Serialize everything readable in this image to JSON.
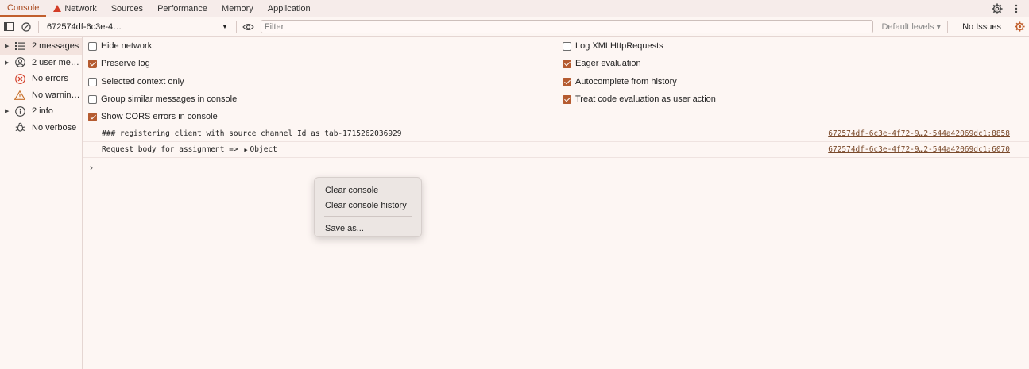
{
  "tabs": [
    {
      "label": "Console",
      "active": true
    },
    {
      "label": "Network",
      "warning": true
    },
    {
      "label": "Sources"
    },
    {
      "label": "Performance"
    },
    {
      "label": "Memory"
    },
    {
      "label": "Application"
    }
  ],
  "toolbar": {
    "context": "672574df-6c3e-4…",
    "filter_placeholder": "Filter",
    "levels": "Default levels ▾",
    "issues": "No Issues"
  },
  "sidebar": {
    "items": [
      {
        "label": "2 messages",
        "icon": "list-icon",
        "expandable": true,
        "selected": true
      },
      {
        "label": "2 user me…",
        "icon": "user-icon",
        "expandable": true
      },
      {
        "label": "No errors",
        "icon": "error-icon"
      },
      {
        "label": "No warnin…",
        "icon": "warning-icon"
      },
      {
        "label": "2 info",
        "icon": "info-icon",
        "expandable": true
      },
      {
        "label": "No verbose",
        "icon": "bug-icon"
      }
    ]
  },
  "settings": {
    "left": [
      {
        "label": "Hide network",
        "checked": false
      },
      {
        "label": "Preserve log",
        "checked": true
      },
      {
        "label": "Selected context only",
        "checked": false
      },
      {
        "label": "Group similar messages in console",
        "checked": false
      },
      {
        "label": "Show CORS errors in console",
        "checked": true
      }
    ],
    "right": [
      {
        "label": "Log XMLHttpRequests",
        "checked": false
      },
      {
        "label": "Eager evaluation",
        "checked": true
      },
      {
        "label": "Autocomplete from history",
        "checked": true
      },
      {
        "label": "Treat code evaluation as user action",
        "checked": true
      }
    ]
  },
  "log": [
    {
      "message": "### registering client with source channel Id as tab-1715262036929",
      "source": "672574df-6c3e-4f72-9…2-544a42069dc1:8858"
    },
    {
      "message": "Request body for assignment => ",
      "object": "Object",
      "source": "672574df-6c3e-4f72-9…2-544a42069dc1:6070"
    }
  ],
  "prompt": "›",
  "context_menu": {
    "items": [
      "Clear console",
      "Clear console history",
      "Save as..."
    ]
  },
  "colors": {
    "accent": "#c15f2d",
    "checkbox": "#b55b30",
    "background": "#fdf6f3"
  }
}
